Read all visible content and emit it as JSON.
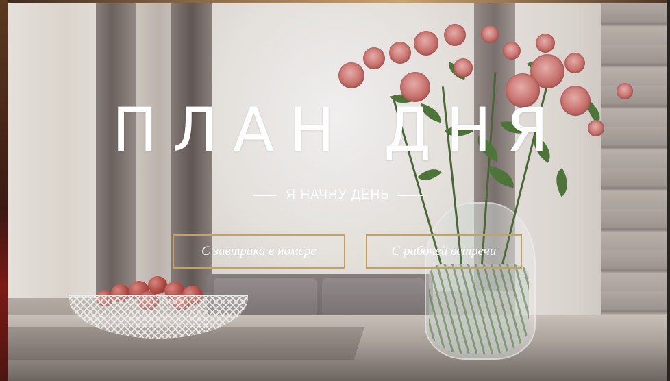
{
  "hero": {
    "title": "ПЛАН ДНЯ",
    "subtitle": "Я НАЧНУ ДЕНЬ"
  },
  "actions": {
    "breakfast_label": "С завтрака в номере",
    "meeting_label": "С рабочей встречи"
  },
  "colors": {
    "button_border": "#c6a25b",
    "text": "#ffffff"
  }
}
